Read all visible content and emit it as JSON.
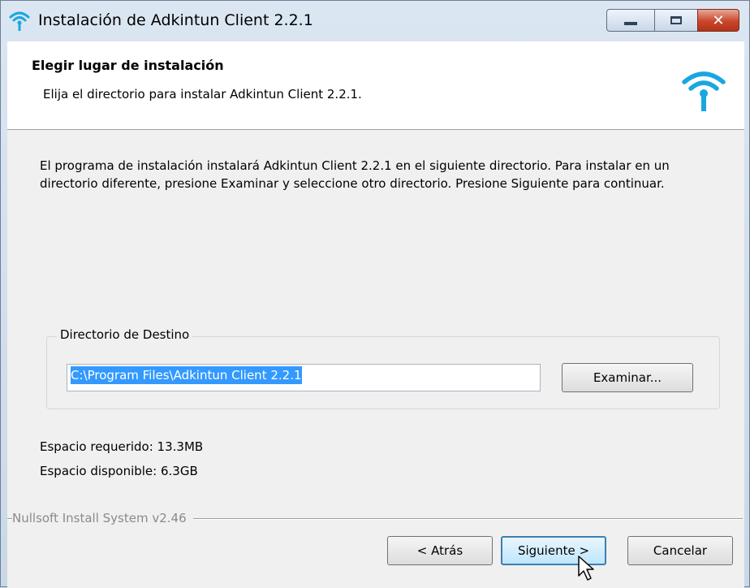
{
  "window": {
    "title": "Instalación de Adkintun Client 2.2.1",
    "controls": {
      "minimize": "minimize",
      "maximize": "maximize",
      "close": "✕"
    }
  },
  "header": {
    "title": "Elegir lugar de instalación",
    "subtitle": "Elija el directorio para instalar Adkintun Client 2.2.1."
  },
  "body": {
    "intro": "El programa de instalación instalará Adkintun Client 2.2.1 en el siguiente directorio. Para instalar en un directorio diferente, presione Examinar y seleccione otro directorio. Presione Siguiente para continuar.",
    "destination": {
      "legend": "Directorio de Destino",
      "path": "C:\\Program Files\\Adkintun Client 2.2.1",
      "browse_label": "Examinar..."
    },
    "space_required": "Espacio requerido: 13.3MB",
    "space_available": "Espacio disponible: 6.3GB"
  },
  "footer": {
    "branding": "Nullsoft Install System v2.46",
    "back_label": "< Atrás",
    "next_label": "Siguiente >",
    "cancel_label": "Cancelar"
  },
  "colors": {
    "accent": "#3399ff",
    "logo": "#1aa6e0",
    "close": "#c9462c"
  },
  "icons": [
    "wifi-icon",
    "minimize-icon",
    "maximize-icon",
    "close-icon",
    "mouse-cursor-icon"
  ]
}
